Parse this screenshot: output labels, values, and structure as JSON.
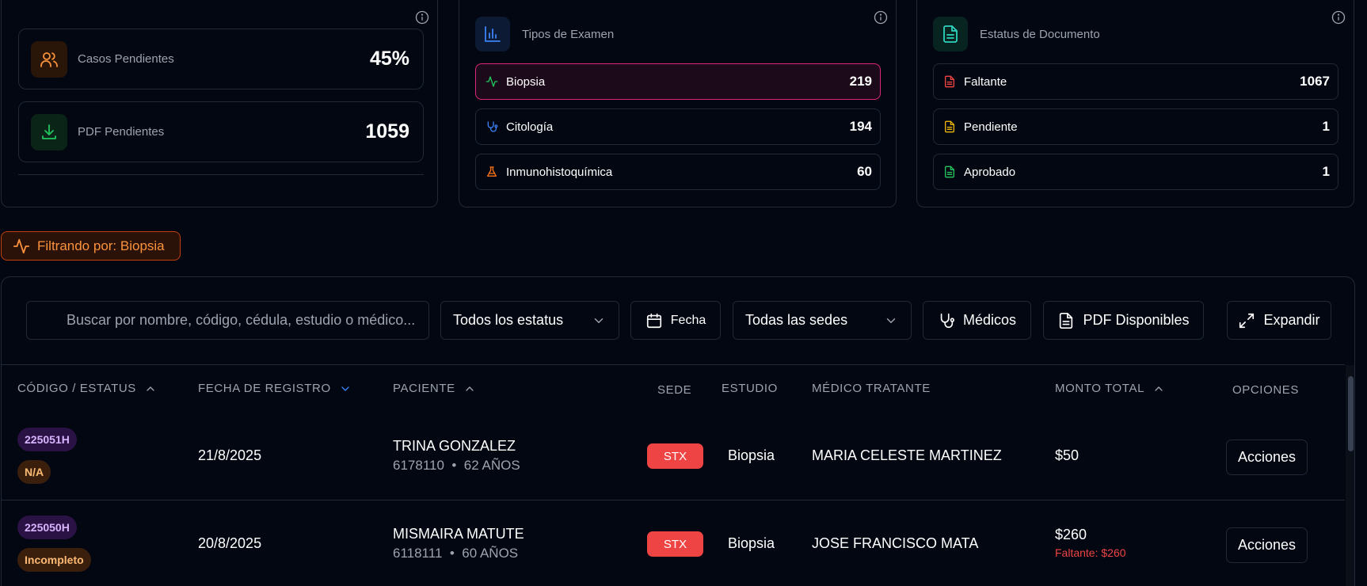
{
  "summary": {
    "casos_label": "Casos Pendientes",
    "casos_value": "45%",
    "pdf_label": "PDF Pendientes",
    "pdf_value": "1059"
  },
  "exam_types": {
    "title": "Tipos de Examen",
    "items": [
      {
        "label": "Biopsia",
        "value": "219",
        "icon": "activity-icon",
        "color": "#22c55e"
      },
      {
        "label": "Citología",
        "value": "194",
        "icon": "stethoscope-icon",
        "color": "#3b82f6"
      },
      {
        "label": "Inmunohistoquímica",
        "value": "60",
        "icon": "flask-icon",
        "color": "#f97316"
      }
    ]
  },
  "doc_status": {
    "title": "Estatus de Documento",
    "items": [
      {
        "label": "Faltante",
        "value": "1067",
        "icon": "document-icon",
        "color": "#ef4444"
      },
      {
        "label": "Pendiente",
        "value": "1",
        "icon": "document-icon",
        "color": "#eab308"
      },
      {
        "label": "Aprobado",
        "value": "1",
        "icon": "document-icon",
        "color": "#22c55e"
      }
    ]
  },
  "filter_chip": "Filtrando por: Biopsia",
  "toolbar": {
    "search_placeholder": "Buscar por nombre, código, cédula, estudio o médico...",
    "status_select": "Todos los estatus",
    "date_label": "Fecha",
    "sede_select": "Todas las sedes",
    "medicos_label": "Médicos",
    "pdf_label": "PDF Disponibles",
    "expand_label": "Expandir"
  },
  "table": {
    "headers": {
      "code": "CÓDIGO / ESTATUS",
      "date": "FECHA DE REGISTRO",
      "patient": "PACIENTE",
      "sede": "SEDE",
      "study": "ESTUDIO",
      "doctor": "MÉDICO TRATANTE",
      "amount": "MONTO TOTAL",
      "options": "OPCIONES"
    },
    "rows": [
      {
        "code": "225051H",
        "status": "N/A",
        "date": "21/8/2025",
        "patient": "TRINA GONZALEZ",
        "patient_id": "6178110",
        "age": "62 AÑOS",
        "sede": "STX",
        "study": "Biopsia",
        "doctor": "MARIA CELESTE MARTINEZ",
        "amount": "$50",
        "missing": "",
        "action": "Acciones"
      },
      {
        "code": "225050H",
        "status": "Incompleto",
        "date": "20/8/2025",
        "patient": "MISMAIRA MATUTE",
        "patient_id": "6118111",
        "age": "60 AÑOS",
        "sede": "STX",
        "study": "Biopsia",
        "doctor": "JOSE FRANCISCO MATA",
        "amount": "$260",
        "missing": "Faltante: $260",
        "action": "Acciones"
      }
    ]
  }
}
